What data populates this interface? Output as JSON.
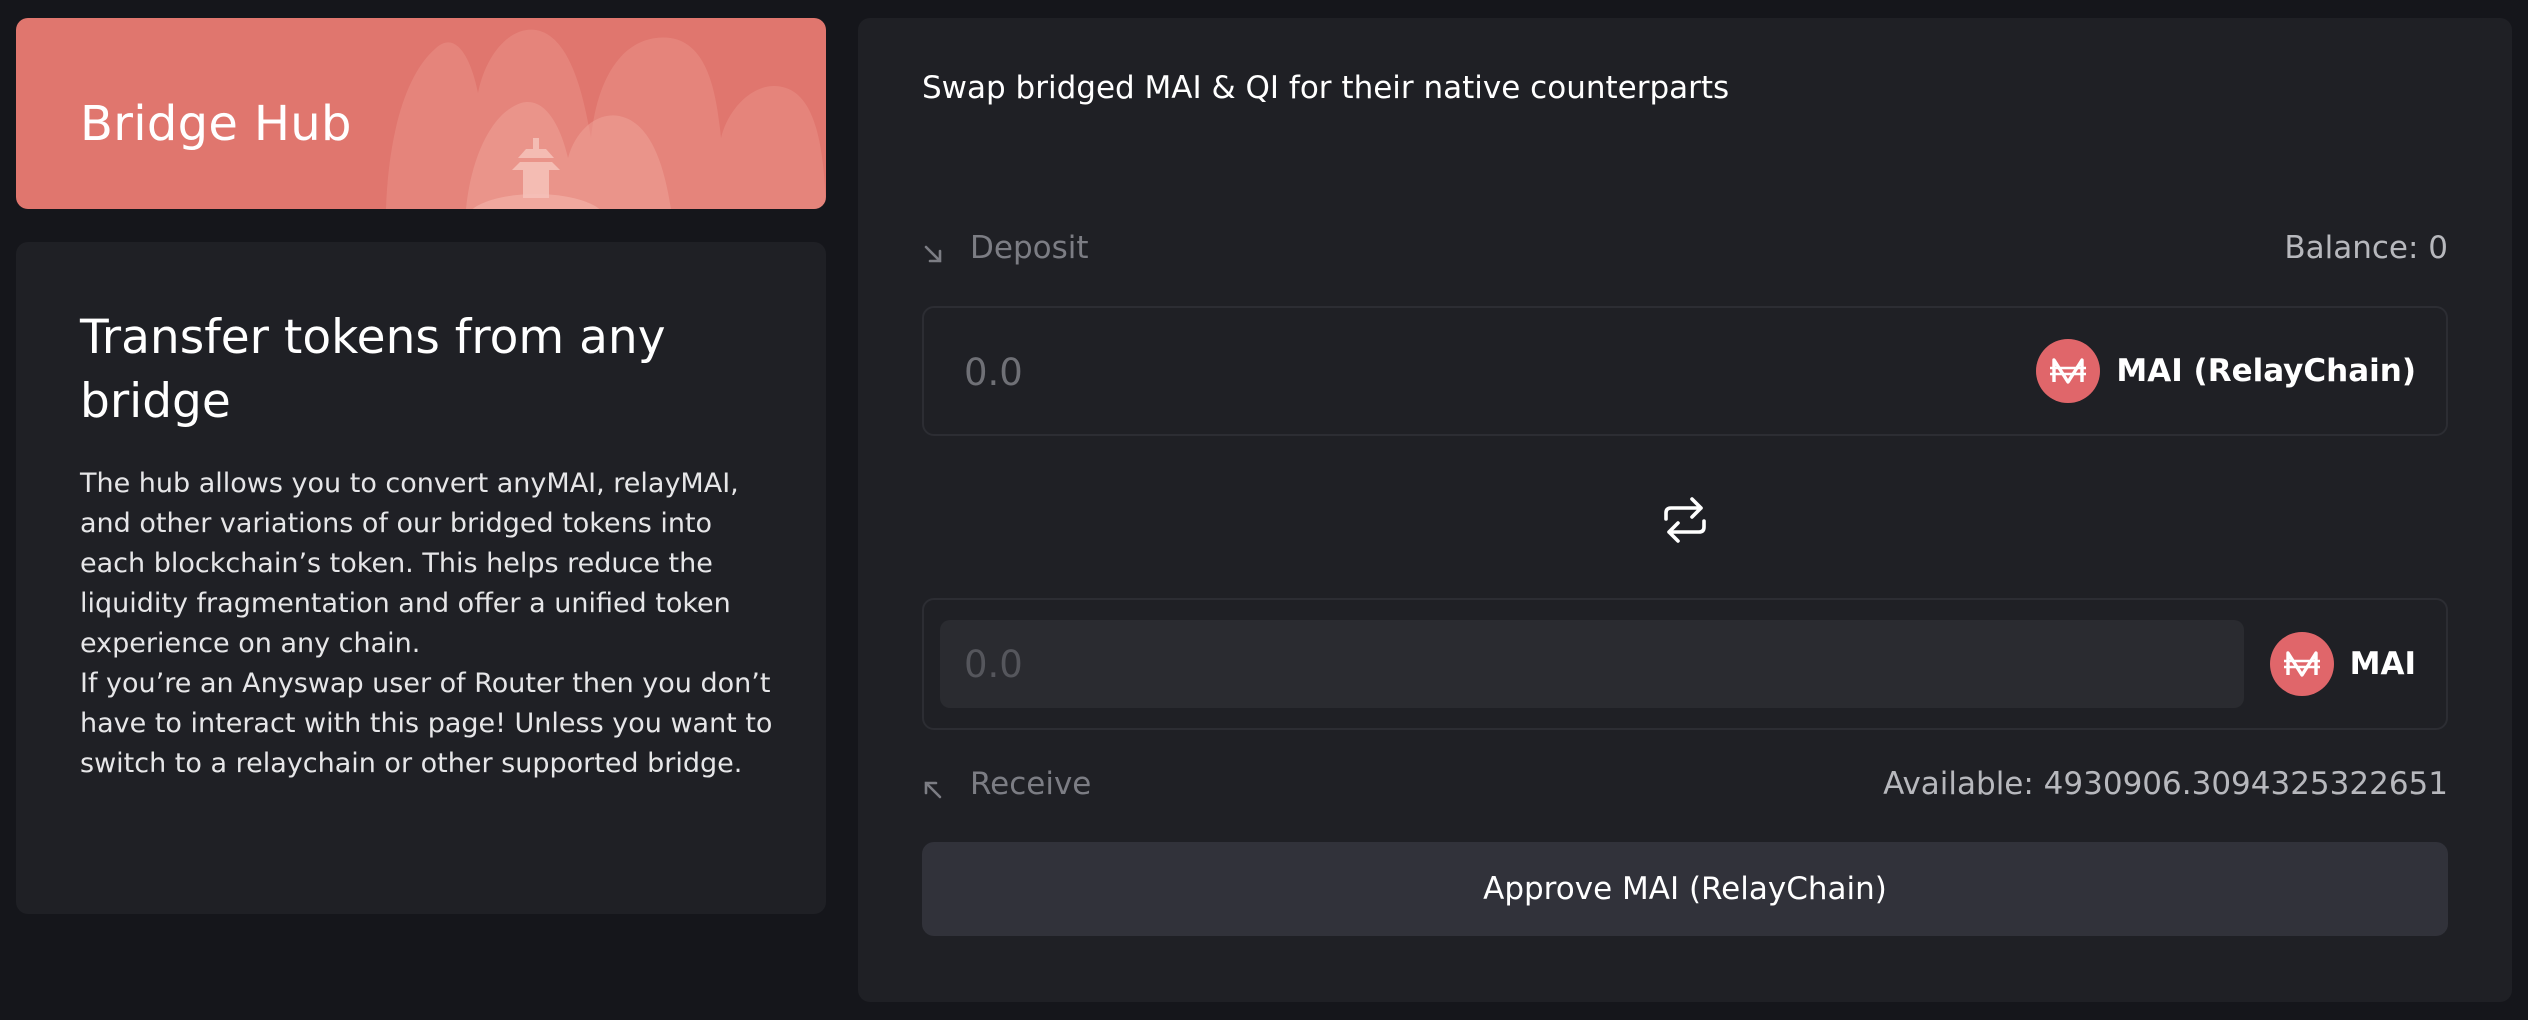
{
  "hero": {
    "title": "Bridge Hub"
  },
  "info": {
    "title": "Transfer tokens from any bridge",
    "paragraph_1": "The hub allows you to convert anyMAI, relayMAI, and other variations of our bridged tokens into each blockchain’s token. This helps reduce the liquidity fragmentation and offer a unified token experience on any chain.",
    "paragraph_2": "If you’re an Anyswap user of Router then you don’t have to interact with this page! Unless you want to switch to a relaychain or other supported bridge."
  },
  "swap": {
    "heading": "Swap bridged MAI & QI for their native counterparts",
    "deposit": {
      "label": "Deposit",
      "balance": "Balance: 0",
      "placeholder": "0.0",
      "value": "",
      "token_name": "MAI (RelayChain)",
      "token_icon": "mai-token-icon"
    },
    "receive": {
      "label": "Receive",
      "available": "Available: 4930906.3094325322651",
      "placeholder": "0.0",
      "value": "",
      "token_name": "MAI",
      "token_icon": "mai-token-icon"
    },
    "swap_icon": "swap-arrows-icon",
    "approve_label": "Approve MAI (RelayChain)"
  },
  "colors": {
    "accent": "#e0766e",
    "panel": "#1f2025",
    "background": "#15161b",
    "button": "#31323a"
  }
}
